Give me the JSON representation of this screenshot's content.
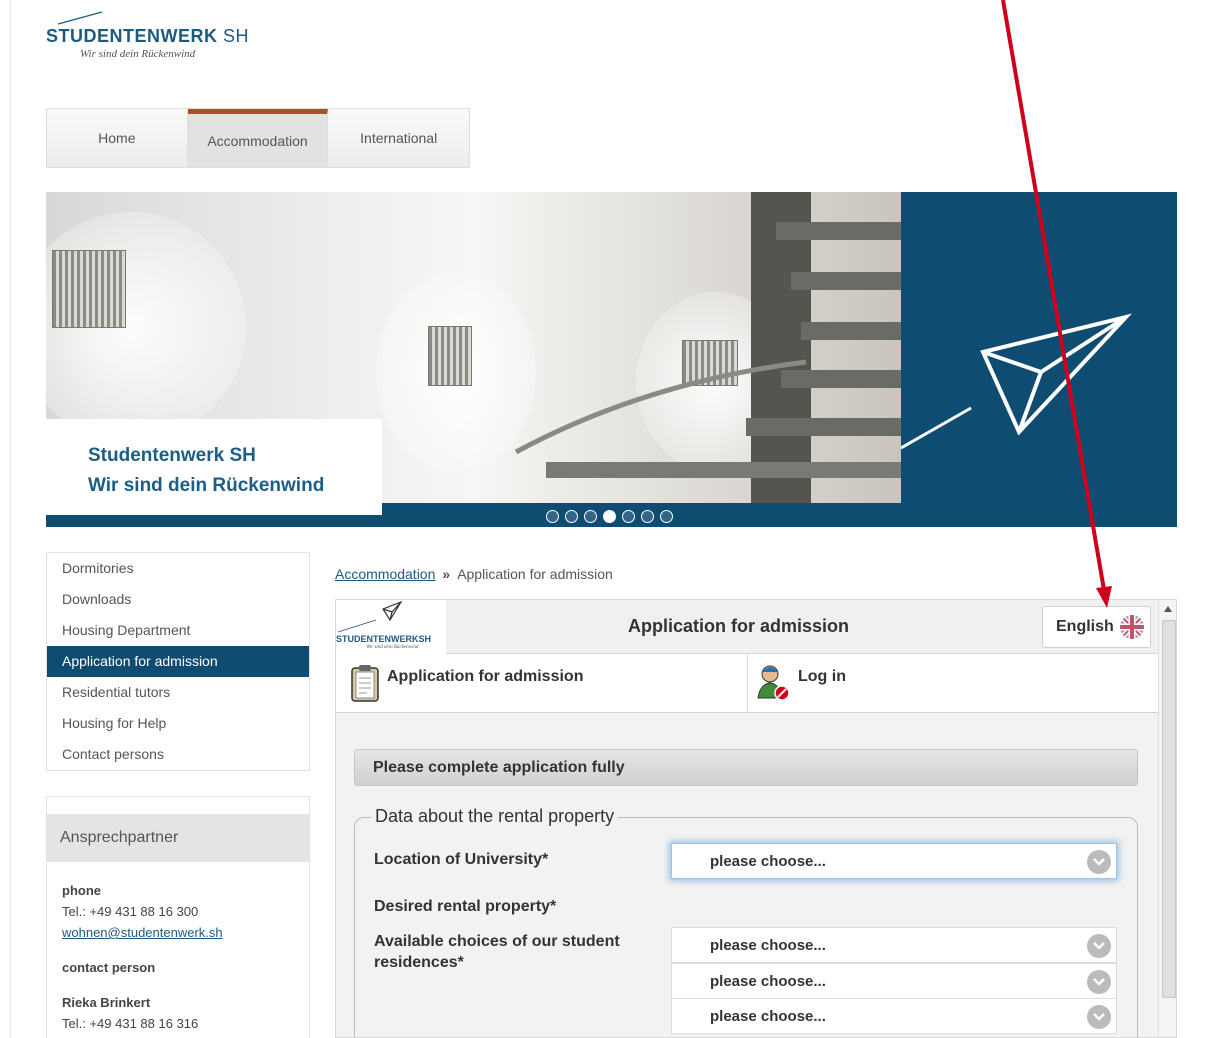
{
  "logo": {
    "name": "STUDENTENWERK",
    "name_suffix": "SH",
    "tagline": "Wir sind dein Rückenwind"
  },
  "nav": {
    "items": [
      {
        "label": "Home"
      },
      {
        "label": "Accommodation"
      },
      {
        "label": "International"
      }
    ],
    "active": "Accommodation"
  },
  "banner": {
    "caption_line1": "Studentenwerk SH",
    "caption_line2": "Wir sind dein Rückenwind",
    "slide_count": 7,
    "active_slide": 4
  },
  "subnav": {
    "items": [
      {
        "label": "Dormitories"
      },
      {
        "label": "Downloads"
      },
      {
        "label": "Housing Department"
      },
      {
        "label": "Application for admission"
      },
      {
        "label": "Residential tutors"
      },
      {
        "label": "Housing for Help"
      },
      {
        "label": "Contact persons"
      }
    ],
    "active": "Application for admission"
  },
  "contact": {
    "heading": "Ansprechpartner",
    "phone_heading": "phone",
    "phone": "Tel.: +49 431 88 16 300",
    "email": "wohnen@studentenwerk.sh",
    "person_heading": "contact person",
    "person_name": "Rieka Brinkert",
    "person_phone": "Tel.: +49 431 88 16 316"
  },
  "breadcrumb": {
    "parent": "Accommodation",
    "separator": "»",
    "current": "Application for admission"
  },
  "app": {
    "logo_name": "STUDENTENWERKSH",
    "logo_tagline": "Wir sind dein Rückenwind",
    "title": "Application for admission",
    "language": "English",
    "tabs": [
      {
        "label": "Application for admission",
        "icon": "clipboard-icon"
      },
      {
        "label": "Log in",
        "icon": "user-login-icon"
      }
    ],
    "notice": "Please complete application fully",
    "fieldset_legend": "Data about the rental property",
    "fields": {
      "location_label": "Location of University*",
      "location_value": "please choose...",
      "desired_label": "Desired rental property*",
      "choices_label": "Available choices of our student residences*",
      "choices": [
        "please choose...",
        "please choose...",
        "please choose..."
      ]
    }
  },
  "colors": {
    "brand_blue": "#0f4c72",
    "nav_accent": "#b84a2c",
    "annotation_arrow": "#d0021b"
  }
}
